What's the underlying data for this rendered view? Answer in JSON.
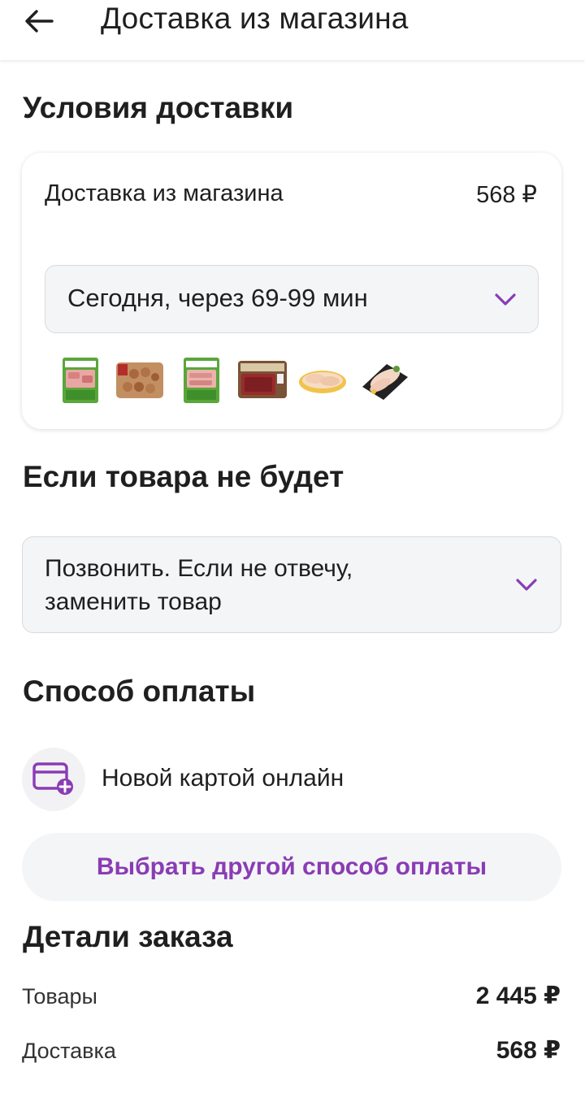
{
  "header": {
    "title": "Доставка из магазина",
    "back_icon": "arrow-left-icon"
  },
  "delivery_conditions": {
    "heading": "Условия доставки",
    "method_label": "Доставка из магазина",
    "method_price": "568 ₽",
    "time_select": {
      "value": "Сегодня, через 69-99 мин",
      "icon": "chevron-down-icon"
    },
    "product_thumbnails": [
      "product-1",
      "product-2",
      "product-3",
      "product-4",
      "product-5",
      "product-6"
    ]
  },
  "out_of_stock": {
    "heading": "Если товара не будет",
    "select": {
      "line1": "Позвонить. Если не отвечу,",
      "line2": "заменить товар",
      "icon": "chevron-down-icon"
    }
  },
  "payment": {
    "heading": "Способ оплаты",
    "method_label": "Новой картой онлайн",
    "method_icon": "card-add-icon",
    "change_button": "Выбрать другой способ оплаты"
  },
  "order_details": {
    "heading": "Детали заказа",
    "rows": [
      {
        "label": "Товары",
        "value": "2 445 ₽"
      },
      {
        "label": "Доставка",
        "value": "568 ₽"
      }
    ]
  },
  "colors": {
    "accent": "#8a3cb4",
    "field_bg": "#f4f5f7",
    "text": "#1f1f1f"
  }
}
